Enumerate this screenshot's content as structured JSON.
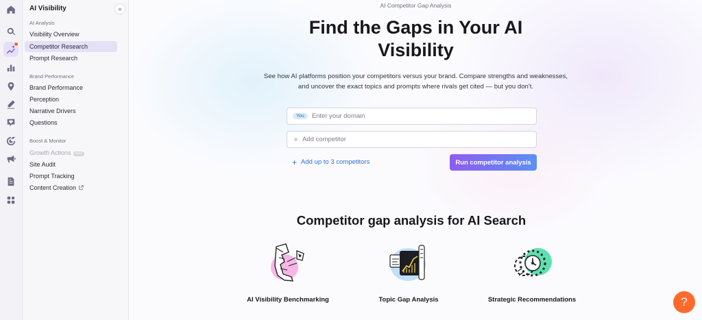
{
  "sidebar": {
    "title": "AI Visibility",
    "collapse_icon": "«",
    "sections": [
      {
        "label": "AI Analysis"
      },
      {
        "label": "Brand Performance"
      },
      {
        "label": "Boost & Monitor"
      }
    ],
    "items": [
      {
        "label": "Visibility Overview"
      },
      {
        "label": "Competitor Research"
      },
      {
        "label": "Prompt Research"
      },
      {
        "label": "Brand Performance"
      },
      {
        "label": "Perception"
      },
      {
        "label": "Narrative Drivers"
      },
      {
        "label": "Questions"
      },
      {
        "label": "Growth Actions",
        "pill": "soon"
      },
      {
        "label": "Site Audit"
      },
      {
        "label": "Prompt Tracking"
      },
      {
        "label": "Content Creation"
      }
    ]
  },
  "rail_icons": [
    "home-icon",
    "prompt-icon",
    "sparkle-chart-icon",
    "bar-chart-icon",
    "location-pin-icon",
    "pencil-icon",
    "heart-chat-icon",
    "target-icon",
    "megaphone-icon",
    "document-icon",
    "apps-grid-icon"
  ],
  "main": {
    "breadcrumb": "AI Competitor Gap Analysis",
    "title": "Find the Gaps in Your AI Visibility",
    "subtitle": "See how AI platforms position your competitors versus your brand. Compare strengths and weaknesses, and uncover the exact topics and prompts where rivals get cited — but you don't.",
    "domain_chip": "You",
    "domain_placeholder": "Enter your domain",
    "competitor_placeholder": "Add competitor",
    "add_link": "Add up to 3 competitors",
    "add_icon": "+",
    "run_button": "Run competitor analysis",
    "section_title": "Competitor gap analysis for AI Search",
    "features": [
      {
        "label": "AI Visibility Benchmarking"
      },
      {
        "label": "Topic Gap Analysis"
      },
      {
        "label": "Strategic Recommendations"
      }
    ]
  },
  "help_label": "?",
  "colors": {
    "accent": "#6a48d9",
    "link": "#2f6fd0",
    "help": "#ff6a2b",
    "badge": "#ff5a1f"
  }
}
